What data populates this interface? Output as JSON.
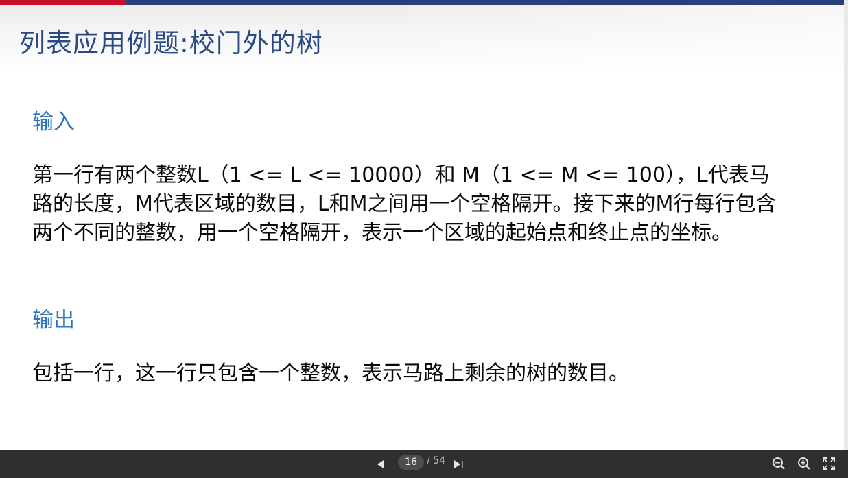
{
  "slide": {
    "title": "列表应用例题:校门外的树",
    "sections": [
      {
        "heading": "输入",
        "body": "第一行有两个整数L（1 <= L <= 10000）和 M（1 <= M <= 100），L代表马路的长度，M代表区域的数目，L和M之间用一个空格隔开。接下来的M行每行包含两个不同的整数，用一个空格隔开，表示一个区域的起始点和终止点的坐标。"
      },
      {
        "heading": "输出",
        "body": "包括一行，这一行只包含一个整数，表示马路上剩余的树的数目。"
      }
    ]
  },
  "viewer": {
    "current_page": "16",
    "total_pages": "/ 54",
    "icons": {
      "prev": "triangle-left-icon",
      "next": "triangle-right-icon",
      "zoom_out": "zoom-out-icon",
      "zoom_in": "zoom-in-icon",
      "fullscreen": "fullscreen-icon"
    }
  },
  "colors": {
    "title": "#2a4a86",
    "heading": "#2d75c0",
    "accent_red": "#c8102e",
    "accent_blue": "#2b3f7a",
    "toolbar": "#2f2f2f"
  }
}
